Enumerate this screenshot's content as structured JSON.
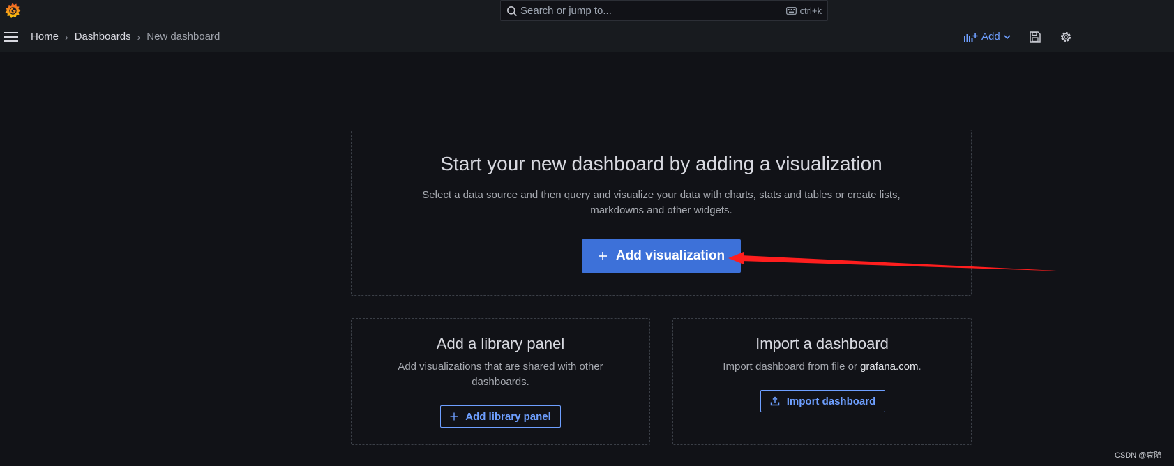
{
  "search": {
    "placeholder": "Search or jump to...",
    "shortcut": "ctrl+k"
  },
  "breadcrumb": {
    "items": [
      "Home",
      "Dashboards"
    ],
    "current": "New dashboard"
  },
  "toolbar": {
    "add_label": "Add"
  },
  "main_card": {
    "title": "Start your new dashboard by adding a visualization",
    "description": "Select a data source and then query and visualize your data with charts, stats and tables or create lists, markdowns and other widgets.",
    "button": "Add visualization"
  },
  "library_card": {
    "title": "Add a library panel",
    "description": "Add visualizations that are shared with other dashboards.",
    "button": "Add library panel"
  },
  "import_card": {
    "title": "Import a dashboard",
    "description_prefix": "Import dashboard from file or ",
    "link": "grafana.com",
    "description_suffix": ".",
    "button": "Import dashboard"
  },
  "watermark": "CSDN @哀随",
  "colors": {
    "background": "#111217",
    "panel": "#181b1f",
    "primary": "#3d71d9",
    "link": "#6e9fff",
    "annotation_arrow": "#ff1e1e"
  },
  "icons": [
    "grafana-logo",
    "search-icon",
    "keyboard-icon",
    "hamburger-menu-icon",
    "add-panel-icon",
    "chevron-down-icon",
    "save-icon",
    "gear-icon",
    "plus-icon",
    "upload-icon"
  ]
}
